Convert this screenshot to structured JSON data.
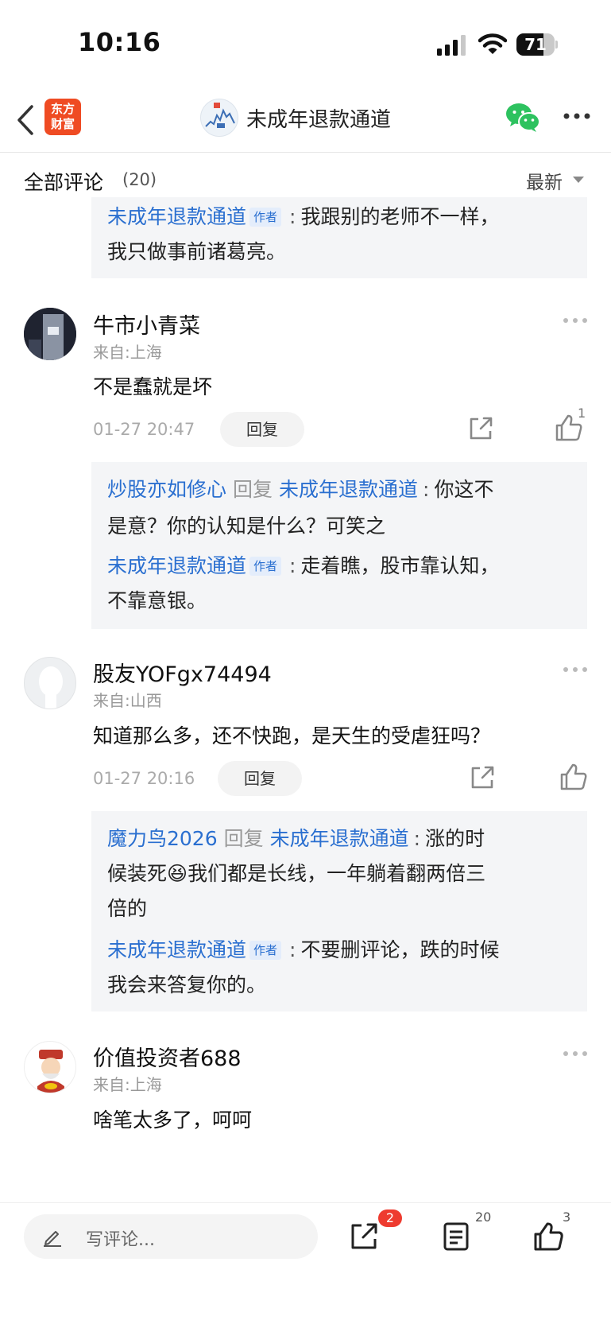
{
  "status_bar": {
    "time": "10:16",
    "battery_level": 71,
    "battery_label": "71"
  },
  "nav": {
    "logo_line1": "东方",
    "logo_line2": "财富",
    "title": "未成年退款通道",
    "icons": {
      "back": "chevron-left-icon",
      "wechat": "wechat-icon",
      "more": "more-icon"
    }
  },
  "comments_header": {
    "title": "全部评论",
    "count": "(20)",
    "sort_label": "最新"
  },
  "top_reply": {
    "name": "未成年退款通道",
    "tag": "作者",
    "line1": "我跟别的老师不一样，",
    "line2": "我只做事前诸葛亮。"
  },
  "comments": [
    {
      "username": "牛市小青菜",
      "location": "来自:上海",
      "text": "不是蠢就是坏",
      "time": "01-27 20:47",
      "reply_label": "回复",
      "likes": "1",
      "replies": [
        {
          "name": "炒股亦如修心",
          "reply_word": "回复",
          "target": "未成年退款通道",
          "line1": "你这不",
          "line2": "是意？你的认知是什么？可笑之"
        },
        {
          "name": "未成年退款通道",
          "tag": "作者",
          "line1": "走着瞧，股市靠认知，",
          "line2": "不靠意银。"
        }
      ]
    },
    {
      "username": "股友YOFgx74494",
      "location": "来自:山西",
      "text": "知道那么多，还不快跑，是天生的受虐狂吗？",
      "time": "01-27 20:16",
      "reply_label": "回复",
      "likes": "",
      "replies": [
        {
          "name": "魔力鸟2026",
          "reply_word": "回复",
          "target": "未成年退款通道",
          "line1": "涨的时",
          "line2_a": "候装死",
          "line2_emoji": "😆",
          "line2_b": "我们都是长线，一年躺着翻两倍三",
          "line3": "倍的"
        },
        {
          "name": "未成年退款通道",
          "tag": "作者",
          "line1": "不要删评论，跌的时候",
          "line2": "我会来答复你的。"
        }
      ]
    },
    {
      "username": "价值投资者688",
      "location": "来自:上海",
      "text": "啥笔太多了，呵呵"
    }
  ],
  "bottom_bar": {
    "input_placeholder": "写评论...",
    "share_badge": "2",
    "comment_count": "20",
    "like_count": "3"
  }
}
